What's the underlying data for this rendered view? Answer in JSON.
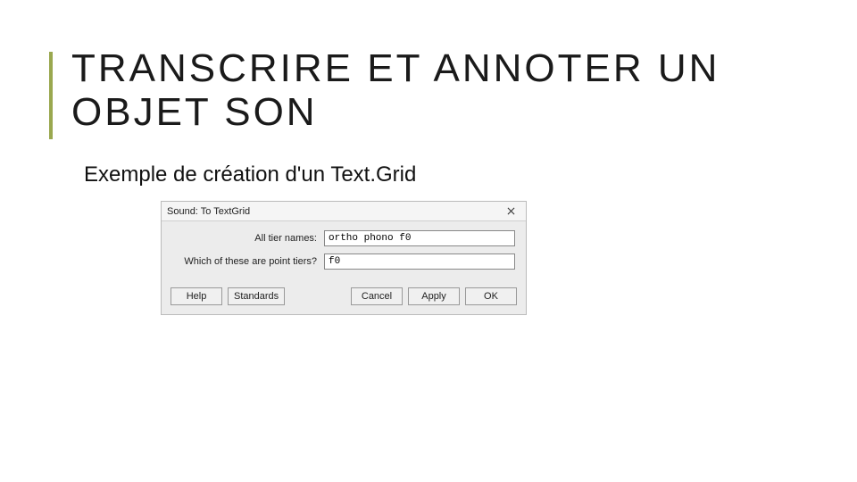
{
  "slide": {
    "title": "TRANSCRIRE ET ANNOTER UN OBJET SON",
    "subtitle": "Exemple de création d'un Text.Grid"
  },
  "dialog": {
    "title": "Sound: To TextGrid",
    "fields": {
      "tier_names_label": "All tier names:",
      "tier_names_value": "ortho phono f0",
      "point_tiers_label": "Which of these are point tiers?",
      "point_tiers_value": "f0"
    },
    "buttons": {
      "help": "Help",
      "standards": "Standards",
      "cancel": "Cancel",
      "apply": "Apply",
      "ok": "OK"
    }
  }
}
